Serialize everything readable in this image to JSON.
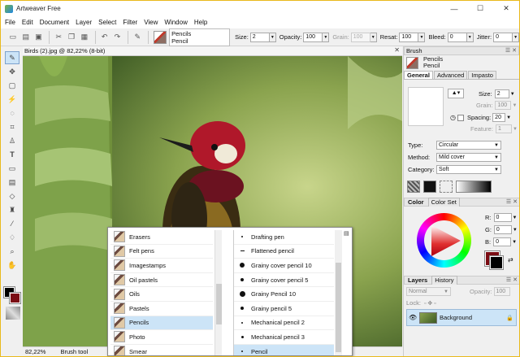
{
  "window": {
    "title": "Artweaver Free",
    "controls": [
      "—",
      "☐",
      "✕"
    ]
  },
  "menu": [
    "File",
    "Edit",
    "Document",
    "Layer",
    "Select",
    "Filter",
    "View",
    "Window",
    "Help"
  ],
  "toolbar": {
    "brush_category": "Pencils",
    "brush_name": "Pencil",
    "size_label": "Size:",
    "size_value": "2",
    "opacity_label": "Opacity:",
    "opacity_value": "100",
    "grain_label": "Grain:",
    "grain_value": "100",
    "resat_label": "Resat:",
    "resat_value": "100",
    "bleed_label": "Bleed:",
    "bleed_value": "0",
    "jitter_label": "Jitter:",
    "jitter_value": "0"
  },
  "document": {
    "tab_title": "Birds (2).jpg @ 82,22% (8-bit)",
    "close_icon": "✕",
    "zoom": "82,22%",
    "status_tool": "Brush tool"
  },
  "popup": {
    "categories": [
      "Erasers",
      "Felt pens",
      "Imagestamps",
      "Oil pastels",
      "Oils",
      "Pastels",
      "Pencils",
      "Photo",
      "Smear"
    ],
    "selected_category": "Pencils",
    "brushes": [
      "Drafting pen",
      "Flattened pencil",
      "Grainy cover pencil 10",
      "Grainy cover pencil 5",
      "Grainy Pencil 10",
      "Grainy pencil 5",
      "Mechanical pencil 2",
      "Mechanical pencil 3",
      "Pencil"
    ],
    "selected_brush": "Pencil"
  },
  "brush_panel": {
    "title": "Brush",
    "category": "Pencils",
    "name": "Pencil",
    "tabs": [
      "General",
      "Advanced",
      "Impasto"
    ],
    "active_tab": "General",
    "size_label": "Size:",
    "size_value": "2",
    "grain_label": "Grain:",
    "grain_value": "100",
    "spacing_label": "Spacing:",
    "spacing_value": "20",
    "feature_label": "Feature:",
    "feature_value": "1",
    "type_label": "Type:",
    "type_value": "Circular",
    "method_label": "Method:",
    "method_value": "Mild cover",
    "cat_label": "Category:",
    "cat_value": "Soft"
  },
  "color_panel": {
    "tabs": [
      "Color",
      "Color Set"
    ],
    "r_label": "R:",
    "r_value": "0",
    "g_label": "G:",
    "g_value": "0",
    "b_label": "B:",
    "b_value": "0",
    "foreground": "#000000",
    "background": "#7b0c13"
  },
  "layers_panel": {
    "tabs": [
      "Layers",
      "History"
    ],
    "blend_mode": "Normal",
    "opacity_label": "Opacity:",
    "opacity_value": "100",
    "lock_label": "Lock:",
    "layers": [
      {
        "name": "Background"
      }
    ]
  }
}
